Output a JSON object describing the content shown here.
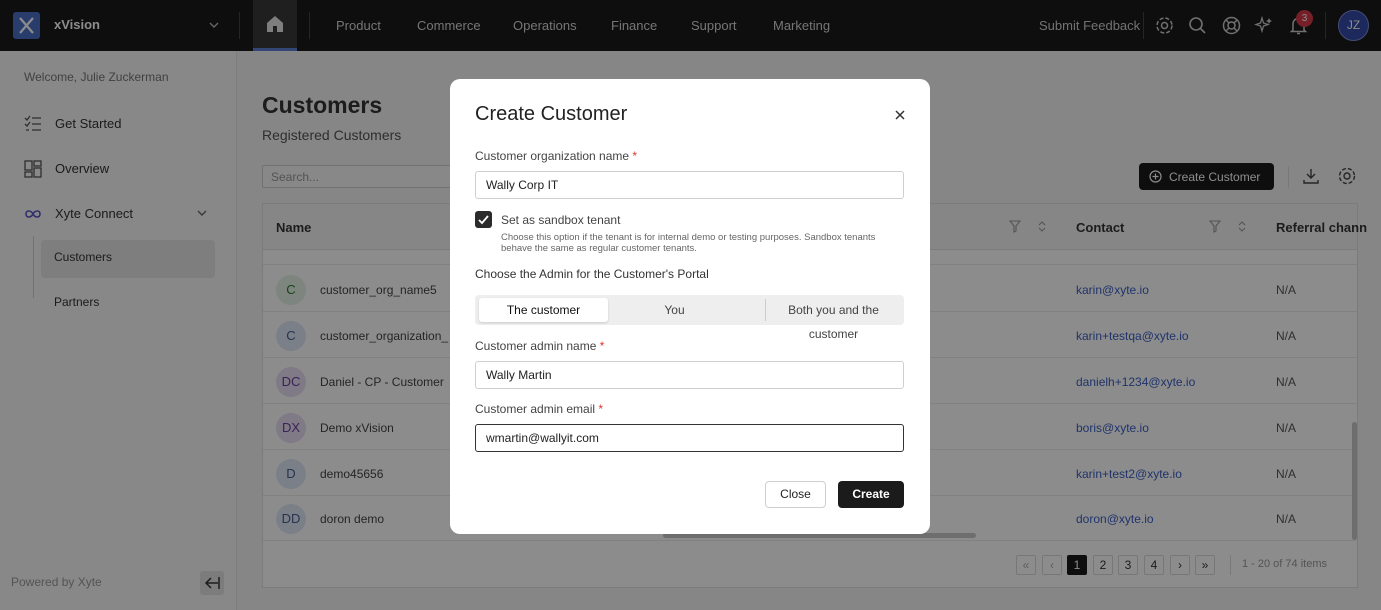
{
  "app": {
    "brand": "xVision"
  },
  "topnav": {
    "items": [
      "Product",
      "Commerce",
      "Operations",
      "Finance",
      "Support",
      "Marketing"
    ],
    "feedback": "Submit Feedback",
    "notifications_count": "3",
    "user_initials": "JZ"
  },
  "sidebar": {
    "welcome": "Welcome, Julie Zuckerman",
    "items": [
      "Get Started",
      "Overview",
      "Xyte Connect"
    ],
    "subitems": [
      "Customers",
      "Partners"
    ],
    "powered_by": "Powered by Xyte"
  },
  "main": {
    "title": "Customers",
    "subtitle": "Registered Customers",
    "search_placeholder": "Search...",
    "create_button": "Create Customer",
    "columns": [
      "Name",
      "Contact",
      "Referral chann"
    ],
    "rows": [
      {
        "initials": "C",
        "name": "customer_org_name5",
        "contact": "karin@xyte.io",
        "referral": "N/A"
      },
      {
        "initials": "C",
        "name": "customer_organization_",
        "contact": "karin+testqa@xyte.io",
        "referral": "N/A"
      },
      {
        "initials": "DC",
        "name": "Daniel - CP - Customer",
        "contact": "danielh+1234@xyte.io",
        "referral": "N/A"
      },
      {
        "initials": "DX",
        "name": "Demo xVision",
        "contact": "boris@xyte.io",
        "referral": "N/A"
      },
      {
        "initials": "D",
        "name": "demo45656",
        "contact": "karin+test2@xyte.io",
        "referral": "N/A"
      },
      {
        "initials": "DD",
        "name": "doron demo",
        "contact": "doron@xyte.io",
        "referral": "N/A"
      }
    ],
    "pagination": {
      "pages": [
        "1",
        "2",
        "3",
        "4"
      ],
      "first": "«",
      "prev": "‹",
      "next": "›",
      "last": "»",
      "info": "1 - 20 of 74 items"
    }
  },
  "modal": {
    "title": "Create Customer",
    "org_label": "Customer organization name",
    "org_value": "Wally Corp IT",
    "required_mark": "*",
    "sandbox_label": "Set as sandbox tenant",
    "sandbox_help": "Choose this option if the tenant is for internal demo or testing purposes. Sandbox tenants behave the same as regular customer tenants.",
    "sandbox_checked": true,
    "admin_section": "Choose the Admin for the Customer's Portal",
    "admin_options": [
      "The customer",
      "You",
      "Both you and the customer"
    ],
    "admin_selected": "The customer",
    "admin_name_label": "Customer admin name",
    "admin_name_value": "Wally Martin",
    "admin_email_label": "Customer admin email",
    "admin_email_value": "wmartin@wallyit.com",
    "close_button": "Close",
    "create_button": "Create"
  },
  "colors": {
    "avatar_green": "#e3f3e5",
    "avatar_purple": "#e8dff5",
    "avatar_blue": "#dfe8f7",
    "link": "#3b5fc4",
    "accent": "#5b7fd6"
  }
}
